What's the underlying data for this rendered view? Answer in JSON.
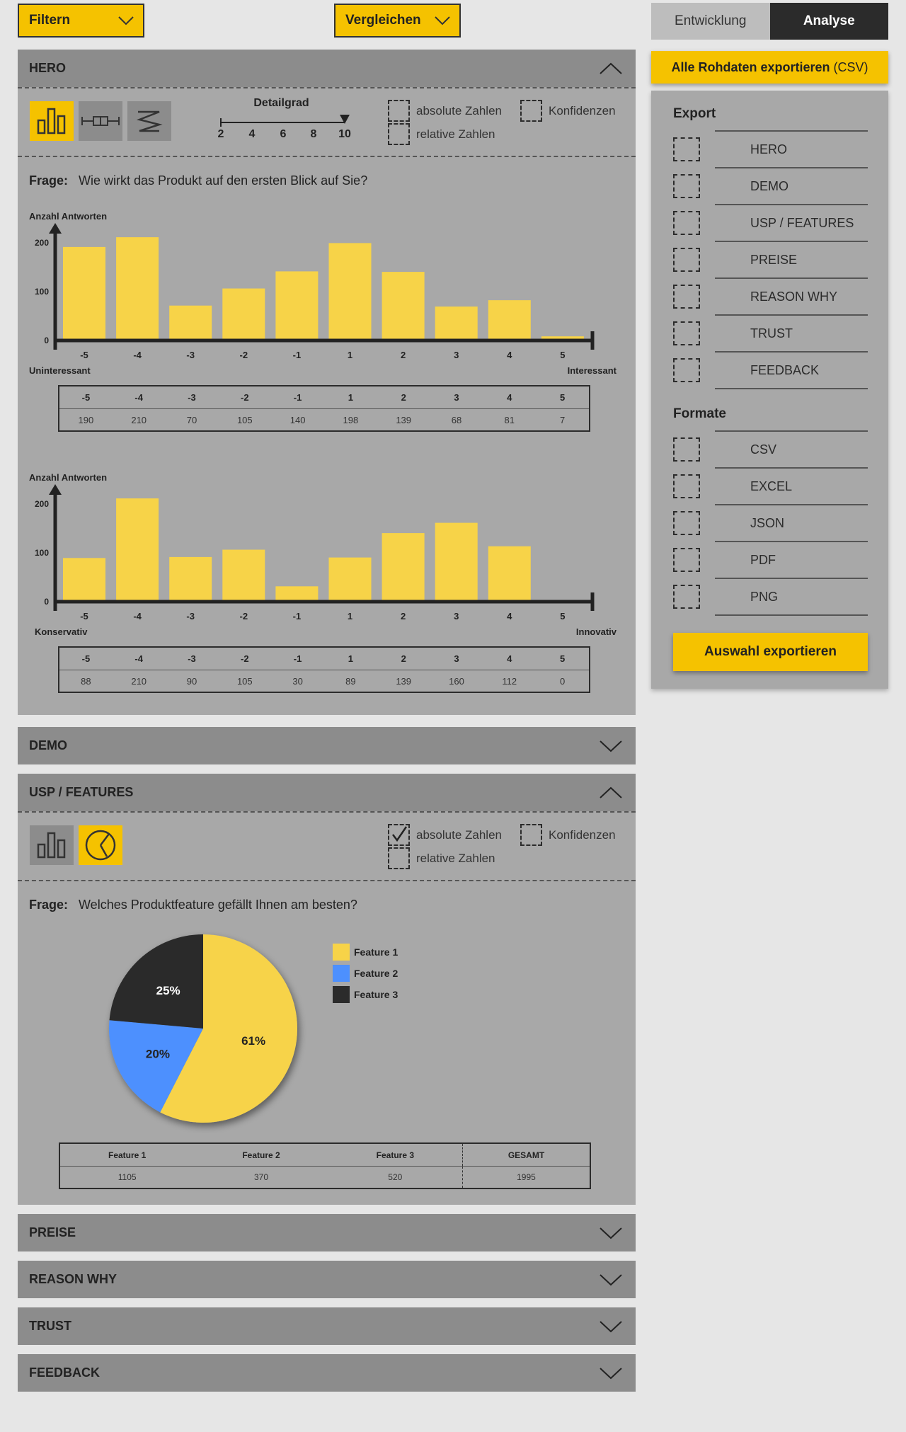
{
  "toolbar": {
    "filter_label": "Filtern",
    "compare_label": "Vergleichen"
  },
  "mode_tabs": [
    "Entwicklung",
    "Analyse"
  ],
  "export_all": {
    "bold": "Alle Rohdaten exportieren",
    "suffix": "(CSV)"
  },
  "export_panel": {
    "export_heading": "Export",
    "export_items": [
      "HERO",
      "DEMO",
      "USP / FEATURES",
      "PREISE",
      "REASON WHY",
      "TRUST",
      "FEEDBACK"
    ],
    "format_heading": "Formate",
    "format_items": [
      "CSV",
      "EXCEL",
      "JSON",
      "PDF",
      "PNG"
    ],
    "button_label": "Auswahl exportieren"
  },
  "hero": {
    "title": "HERO",
    "detail": {
      "label": "Detailgrad",
      "ticks": [
        "2",
        "4",
        "6",
        "8",
        "10"
      ],
      "selected": "10"
    },
    "options": {
      "absolute": "absolute Zahlen",
      "relative": "relative Zahlen",
      "confidence": "Konfidenzen"
    },
    "question_label": "Frage:",
    "question": "Wie wirkt das Produkt auf den ersten Blick auf Sie?"
  },
  "usp": {
    "title": "USP / FEATURES",
    "options": {
      "absolute": "absolute Zahlen",
      "relative": "relative Zahlen",
      "confidence": "Konfidenzen",
      "absolute_checked": true
    },
    "question_label": "Frage:",
    "question": "Welches Produktfeature gefällt Ihnen am besten?",
    "table_headers": [
      "Feature 1",
      "Feature 2",
      "Feature 3",
      "GESAMT"
    ],
    "table_values": [
      "1105",
      "370",
      "520",
      "1995"
    ]
  },
  "collapsed_sections": [
    "DEMO",
    "PREISE",
    "REASON WHY",
    "TRUST",
    "FEEDBACK"
  ],
  "colors": {
    "accent": "#f5c200",
    "bar": "#f7d348",
    "blue": "#4d90fe",
    "dark": "#2b2b2b"
  },
  "chart_data": [
    {
      "type": "bar",
      "ylabel": "Anzahl Antworten",
      "categories": [
        "-5",
        "-4",
        "-3",
        "-2",
        "-1",
        "1",
        "2",
        "3",
        "4",
        "5"
      ],
      "values": [
        190,
        210,
        70,
        105,
        140,
        198,
        139,
        68,
        81,
        7
      ],
      "yticks": [
        "0",
        "100",
        "200"
      ],
      "ylim": [
        0,
        230
      ],
      "low_label": "Uninteressant",
      "high_label": "Interessant",
      "table_headers": [
        "-5",
        "-4",
        "-3",
        "-2",
        "-1",
        "1",
        "2",
        "3",
        "4",
        "5"
      ],
      "table_values": [
        "190",
        "210",
        "70",
        "105",
        "140",
        "198",
        "139",
        "68",
        "81",
        "7"
      ]
    },
    {
      "type": "bar",
      "ylabel": "Anzahl Antworten",
      "categories": [
        "-5",
        "-4",
        "-3",
        "-2",
        "-1",
        "1",
        "2",
        "3",
        "4",
        "5"
      ],
      "values": [
        88,
        210,
        90,
        105,
        30,
        89,
        139,
        160,
        112,
        0
      ],
      "yticks": [
        "0",
        "100",
        "200"
      ],
      "ylim": [
        0,
        230
      ],
      "low_label": "Konservativ",
      "high_label": "Innovativ",
      "table_headers": [
        "-5",
        "-4",
        "-3",
        "-2",
        "-1",
        "1",
        "2",
        "3",
        "4",
        "5"
      ],
      "table_values": [
        "88",
        "210",
        "90",
        "105",
        "30",
        "89",
        "139",
        "160",
        "112",
        "0"
      ]
    },
    {
      "type": "pie",
      "series": [
        {
          "name": "Feature 1",
          "value": 61,
          "label": "61%",
          "color": "#f7d348"
        },
        {
          "name": "Feature 2",
          "value": 20,
          "label": "20%",
          "color": "#4d90fe"
        },
        {
          "name": "Feature 3",
          "value": 25,
          "label": "25%",
          "color": "#2b2b2b"
        }
      ]
    }
  ]
}
